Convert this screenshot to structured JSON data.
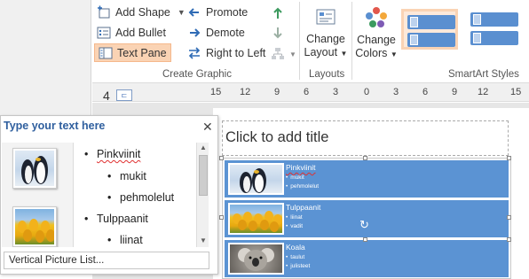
{
  "ribbon": {
    "create_graphic": {
      "add_shape": "Add Shape",
      "add_bullet": "Add Bullet",
      "text_pane": "Text Pane",
      "promote": "Promote",
      "demote": "Demote",
      "right_to_left": "Right to Left",
      "group_label": "Create Graphic"
    },
    "layouts": {
      "change_layout": "Change",
      "change_layout_2": "Layout",
      "group_label": "Layouts"
    },
    "change_colors": {
      "line1": "Change",
      "line2": "Colors"
    },
    "smartart_styles": {
      "group_label": "SmartArt Styles"
    },
    "accent_color": "#5a8fd0"
  },
  "ruler": {
    "ticks": [
      "15",
      "12",
      "9",
      "6",
      "3",
      "0",
      "3",
      "6",
      "9",
      "12",
      "15"
    ]
  },
  "slide_panel": {
    "slide_number": "4"
  },
  "slide": {
    "title_placeholder": "Click to add title",
    "rows": [
      {
        "title": "Pinkviinit",
        "bullets": [
          "mukit",
          "pehmolelut"
        ],
        "picture": "penguin"
      },
      {
        "title": "Tulppaanit",
        "bullets": [
          "liinat",
          "vadit"
        ],
        "picture": "tulip"
      },
      {
        "title": "Koala",
        "bullets": [
          "taulut",
          "julisteet"
        ],
        "picture": "koala"
      }
    ]
  },
  "text_pane": {
    "header": "Type your text here",
    "items": [
      {
        "text": "Pinkviinit",
        "level": 1
      },
      {
        "text": "mukit",
        "level": 2
      },
      {
        "text": "pehmolelut",
        "level": 2
      },
      {
        "text": "Tulppaanit",
        "level": 1
      },
      {
        "text": "liinat",
        "level": 2
      }
    ],
    "footer": "Vertical Picture List..."
  }
}
